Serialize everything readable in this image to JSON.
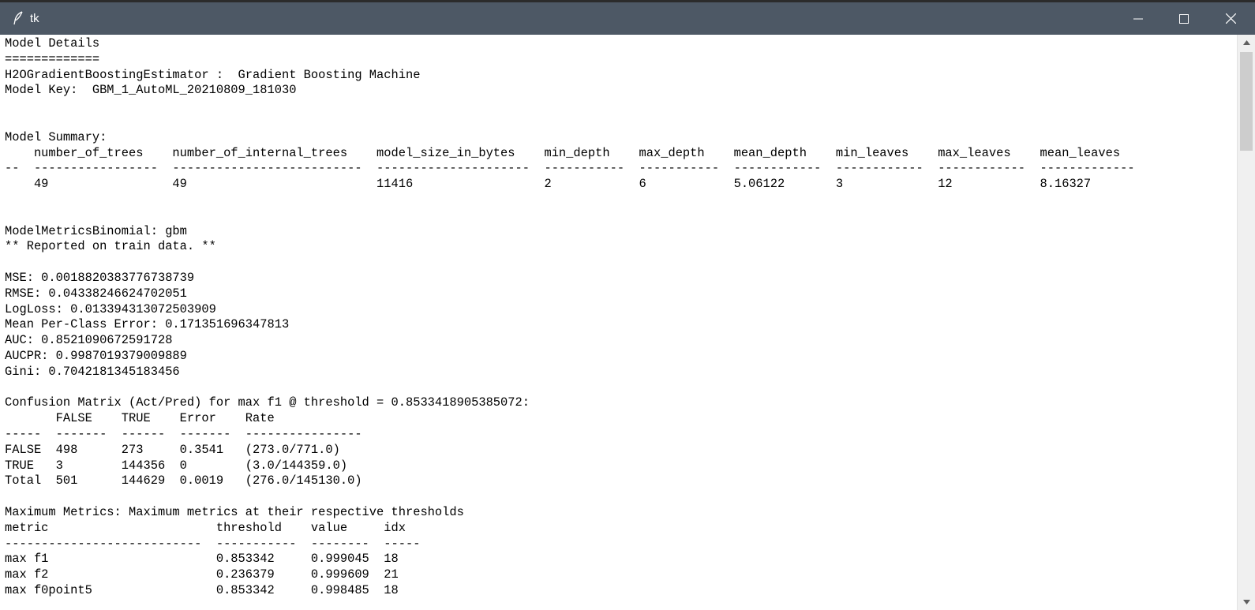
{
  "window": {
    "title": "tk",
    "icon": "feather-icon",
    "controls": [
      "minimize-icon",
      "maximize-icon",
      "close-icon"
    ]
  },
  "output": {
    "lines": [
      "Model Details",
      "=============",
      "H2OGradientBoostingEstimator :  Gradient Boosting Machine",
      "Model Key:  GBM_1_AutoML_20210809_181030",
      "",
      "",
      "Model Summary:",
      "    number_of_trees    number_of_internal_trees    model_size_in_bytes    min_depth    max_depth    mean_depth    min_leaves    max_leaves    mean_leaves",
      "--  -----------------  --------------------------  ---------------------  -----------  -----------  ------------  ------------  ------------  -------------",
      "    49                 49                          11416                  2            6            5.06122       3             12            8.16327",
      "",
      "",
      "ModelMetricsBinomial: gbm",
      "** Reported on train data. **",
      "",
      "MSE: 0.0018820383776738739",
      "RMSE: 0.04338246624702051",
      "LogLoss: 0.013394313072503909",
      "Mean Per-Class Error: 0.171351696347813",
      "AUC: 0.8521090672591728",
      "AUCPR: 0.9987019379009889",
      "Gini: 0.7042181345183456",
      "",
      "Confusion Matrix (Act/Pred) for max f1 @ threshold = 0.8533418905385072:",
      "       FALSE    TRUE    Error    Rate",
      "-----  -------  ------  -------  ----------------",
      "FALSE  498      273     0.3541   (273.0/771.0)",
      "TRUE   3        144356  0        (3.0/144359.0)",
      "Total  501      144629  0.0019   (276.0/145130.0)",
      "",
      "Maximum Metrics: Maximum metrics at their respective thresholds",
      "metric                       threshold    value     idx",
      "---------------------------  -----------  --------  -----",
      "max f1                       0.853342     0.999045  18",
      "max f2                       0.236379     0.999609  21",
      "max f0point5                 0.853342     0.998485  18"
    ]
  },
  "scrollbar": {
    "up_icon": "scroll-up-arrow-icon",
    "down_icon": "scroll-down-arrow-icon",
    "position_fraction": 0.0
  }
}
